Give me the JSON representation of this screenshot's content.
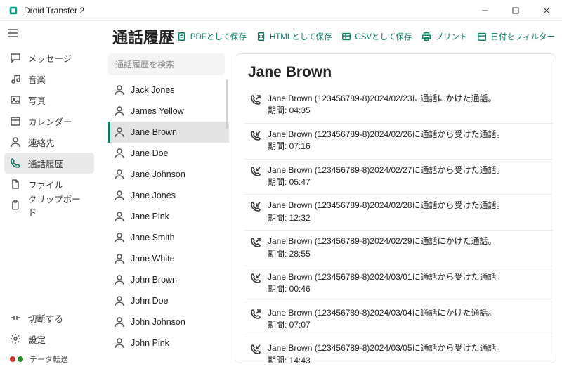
{
  "app_title": "Droid Transfer 2",
  "leftnav": {
    "items": [
      {
        "key": "messages",
        "label": "メッセージ"
      },
      {
        "key": "music",
        "label": "音楽"
      },
      {
        "key": "photos",
        "label": "写真"
      },
      {
        "key": "calendar",
        "label": "カレンダー"
      },
      {
        "key": "contacts",
        "label": "連絡先"
      },
      {
        "key": "calllog",
        "label": "通話履歴"
      },
      {
        "key": "files",
        "label": "ファイル"
      },
      {
        "key": "clipboard",
        "label": "クリップボード"
      }
    ],
    "selected_key": "calllog",
    "bottom": [
      {
        "key": "disconnect",
        "label": "切断する"
      },
      {
        "key": "settings",
        "label": "設定"
      }
    ],
    "status_label": "データ転送"
  },
  "page": {
    "title": "通話履歴",
    "toolbar": {
      "save_pdf": "PDFとして保存",
      "save_html": "HTMLとして保存",
      "save_csv": "CSVとして保存",
      "print": "プリント",
      "datefilter": "日付をフィルター"
    }
  },
  "search_placeholder": "通話履歴を検索",
  "selected_contact": "Jane Brown",
  "contacts": [
    "Jack Jones",
    "James Yellow",
    "Jane Brown",
    "Jane Doe",
    "Jane Johnson",
    "Jane Jones",
    "Jane Pink",
    "Jane Smith",
    "Jane White",
    "John Brown",
    "John Doe",
    "John Johnson",
    "John Pink"
  ],
  "duration_label": "期間",
  "calls": [
    {
      "dir": "out",
      "name": "Jane Brown",
      "number": "123456789-8",
      "date": "2024/02/23",
      "note": "に通話にかけた通話。",
      "duration": "04:35"
    },
    {
      "dir": "in",
      "name": "Jane Brown",
      "number": "123456789-8",
      "date": "2024/02/26",
      "note": "に通話から受けた通話。",
      "duration": "07:16"
    },
    {
      "dir": "in",
      "name": "Jane Brown",
      "number": "123456789-8",
      "date": "2024/02/27",
      "note": "に通話から受けた通話。",
      "duration": "05:47"
    },
    {
      "dir": "in",
      "name": "Jane Brown",
      "number": "123456789-8",
      "date": "2024/02/28",
      "note": "に通話から受けた通話。",
      "duration": "12:32"
    },
    {
      "dir": "out",
      "name": "Jane Brown",
      "number": "123456789-8",
      "date": "2024/02/29",
      "note": "に通話にかけた通話。",
      "duration": "28:55"
    },
    {
      "dir": "in",
      "name": "Jane Brown",
      "number": "123456789-8",
      "date": "2024/03/01",
      "note": "に通話から受けた通話。",
      "duration": "00:46"
    },
    {
      "dir": "out",
      "name": "Jane Brown",
      "number": "123456789-8",
      "date": "2024/03/04",
      "note": "に通話にかけた通話。",
      "duration": "07:07"
    },
    {
      "dir": "in",
      "name": "Jane Brown",
      "number": "123456789-8",
      "date": "2024/03/05",
      "note": "に通話から受けた通話。",
      "duration": "14:43"
    }
  ]
}
